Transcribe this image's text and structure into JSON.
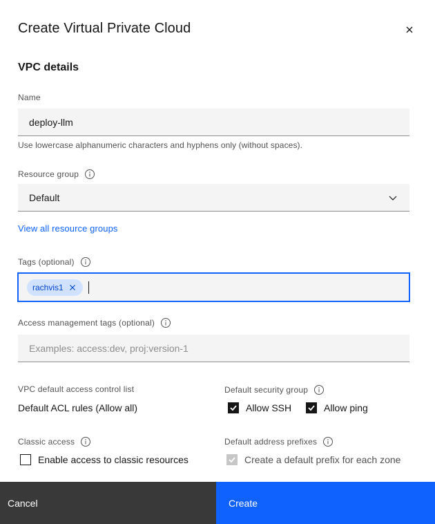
{
  "dialog": {
    "title": "Create Virtual Private Cloud",
    "section_title": "VPC details"
  },
  "name_field": {
    "label": "Name",
    "value": "deploy-llm",
    "helper": "Use lowercase alphanumeric characters and hyphens only (without spaces)."
  },
  "resource_group": {
    "label": "Resource group",
    "selected": "Default",
    "link": "View all resource groups"
  },
  "tags": {
    "label": "Tags (optional)",
    "items": [
      "rachvis1"
    ]
  },
  "access_tags": {
    "label": "Access management tags (optional)",
    "placeholder": "Examples: access:dev, proj:version-1"
  },
  "acl": {
    "label": "VPC default access control list",
    "value": "Default ACL rules (Allow all)"
  },
  "security_group": {
    "label": "Default security group",
    "allow_ssh": "Allow SSH",
    "allow_ping": "Allow ping"
  },
  "classic_access": {
    "label": "Classic access",
    "option": "Enable access to classic resources"
  },
  "address_prefixes": {
    "label": "Default address prefixes",
    "option": "Create a default prefix for each zone"
  },
  "footer": {
    "cancel": "Cancel",
    "create": "Create"
  },
  "colors": {
    "primary": "#0f62fe",
    "secondary_button": "#393939",
    "tag_bg": "#d0e2ff"
  }
}
